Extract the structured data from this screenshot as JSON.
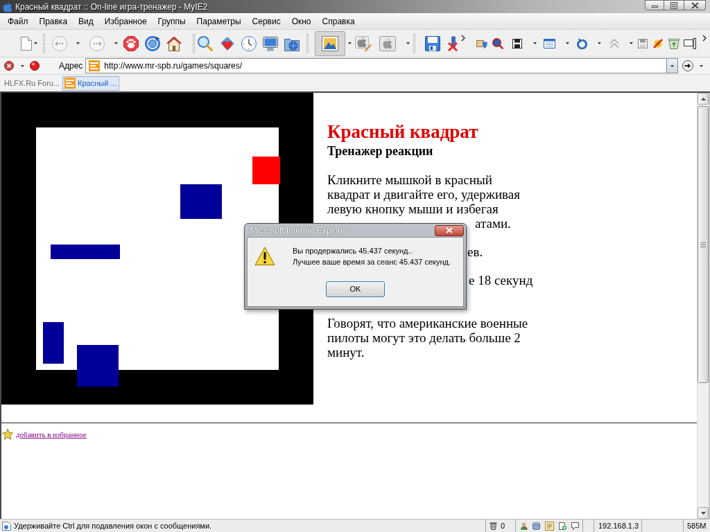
{
  "window": {
    "title": "Красный квадрат :: On-line игра-тренажер - MyIE2"
  },
  "menu": [
    "Файл",
    "Правка",
    "Вид",
    "Избранное",
    "Группы",
    "Параметры",
    "Сервис",
    "Окно",
    "Справка"
  ],
  "toolbar": {
    "image_button_pressed": true
  },
  "address_bar": {
    "label": "Адрес",
    "value": "http://www.mr-spb.ru/games/squares/"
  },
  "tabs": [
    {
      "label": "HLFX.Ru Foru...",
      "favicon": false,
      "selected": false
    },
    {
      "label": "Красный ...",
      "favicon": true,
      "selected": true
    }
  ],
  "page": {
    "game_board": {
      "squares": [
        {
          "color": "#ff0000"
        },
        {
          "color": "#000099"
        },
        {
          "color": "#000099"
        },
        {
          "color": "#000099"
        },
        {
          "color": "#000099"
        }
      ]
    },
    "heading": "Красный квадрат",
    "subheading": "Тренажер реакции",
    "paragraphs": [
      {
        "text": "Кликните мышкой в красный квадрат и двигайте его, удерживая левую кнопку мыши и избегая",
        "covered_tail": "атами."
      },
      {
        "covered_tail": "ев."
      },
      {
        "covered_tail": "е 18 секунд"
      },
      {
        "text": "Говорят, что американские военные пилоты могут это делать больше 2 минут."
      }
    ],
    "favorites_link": "добавить в избранное"
  },
  "dialog": {
    "title": "Microsoft Internet Explorer",
    "message": [
      "Вы продержались 45.437 секунд..",
      "Лучшее ваше время за сеанс 45.437 секунд."
    ],
    "button": "OK"
  },
  "status_bar": {
    "message": "Удерживайте Ctrl для подавления окон с сообщениями.",
    "blocked_count": "0",
    "ip_address": "192.168.1.3",
    "memory": "585M"
  }
}
